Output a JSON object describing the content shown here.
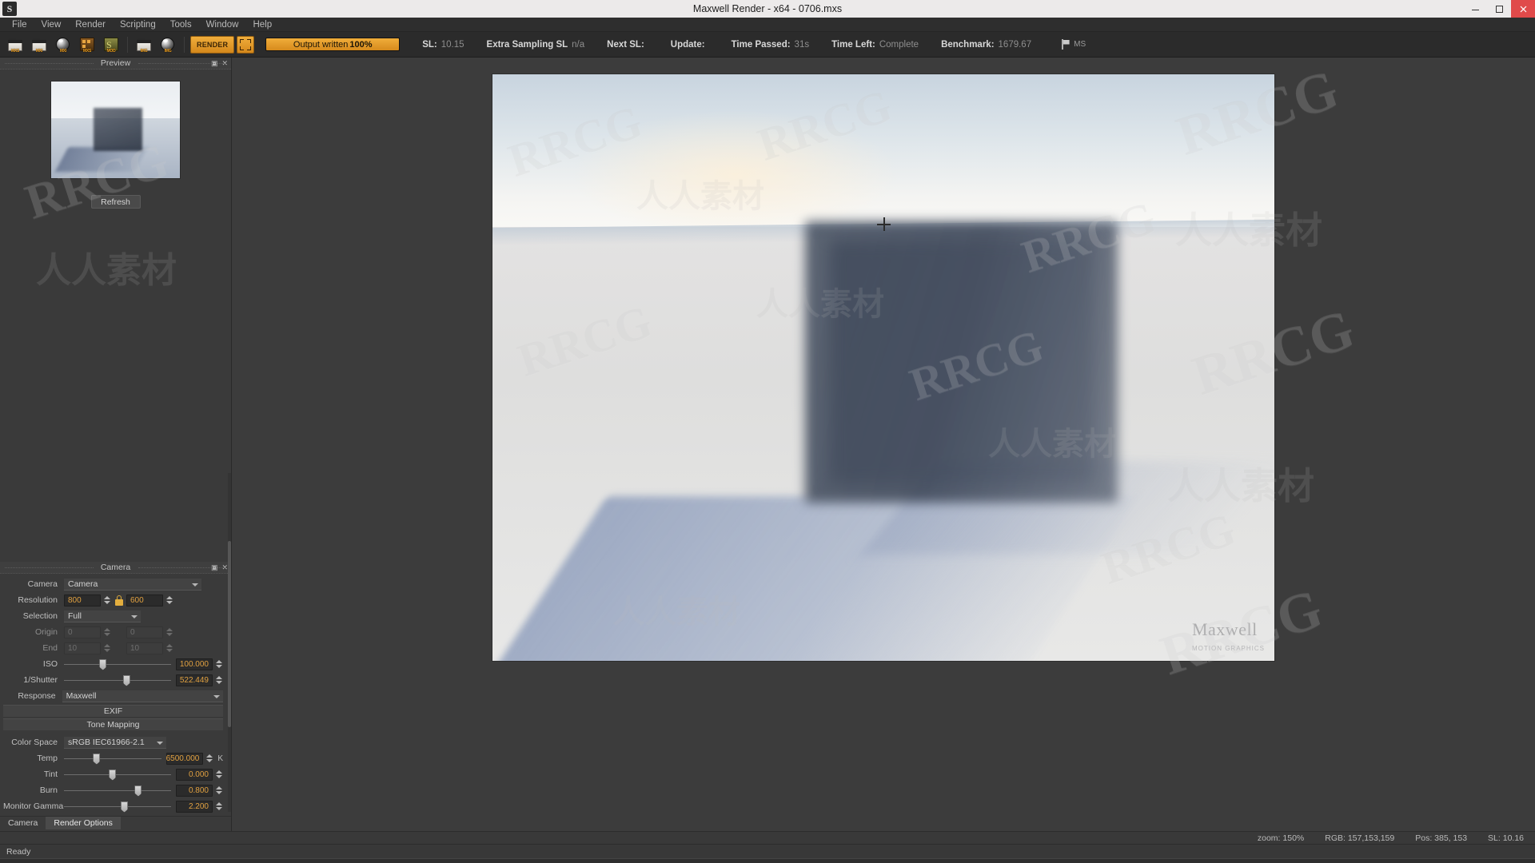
{
  "titlebar": {
    "title": "Maxwell Render  -  x64 - 0706.mxs",
    "logo": "maxwell-logo",
    "minimize": "minimize-button",
    "maximize": "maximize-button",
    "close": "close-button"
  },
  "menubar": {
    "items": [
      {
        "label": "File"
      },
      {
        "label": "View"
      },
      {
        "label": "Render"
      },
      {
        "label": "Scripting"
      },
      {
        "label": "Tools"
      },
      {
        "label": "Window"
      },
      {
        "label": "Help"
      }
    ]
  },
  "toolbar": {
    "buttons": [
      {
        "name": "open-mxs-icon",
        "caption": "MXS"
      },
      {
        "name": "open-mxi-icon",
        "caption": "MXI"
      },
      {
        "name": "save-mxi-icon",
        "caption": "MXI"
      },
      {
        "name": "mxs-material-icon",
        "caption": "MXS"
      },
      {
        "name": "mod-script-icon",
        "caption": "MOD"
      },
      {
        "name": "open-image-icon",
        "caption": "IMG"
      },
      {
        "name": "save-image-icon",
        "caption": "IMG"
      }
    ],
    "render_label": "RENDER",
    "region_label": "region-render",
    "flag_label": "flag-icon",
    "ms_label": "MS"
  },
  "progress": {
    "label": "Output written",
    "percent": "100%",
    "fill": 100,
    "color": "#e0a040"
  },
  "stats": [
    {
      "key": "SL:",
      "value": "10.15"
    },
    {
      "key": "Extra Sampling SL",
      "value": "n/a"
    },
    {
      "key": "Next SL:",
      "value": ""
    },
    {
      "key": "Update:",
      "value": ""
    },
    {
      "key": "Time Passed:",
      "value": "31s"
    },
    {
      "key": "Time Left:",
      "value": "Complete"
    },
    {
      "key": "Benchmark:",
      "value": "1679.67"
    }
  ],
  "preview_panel": {
    "title": "Preview",
    "pin": "▣",
    "close": "✕",
    "refresh_label": "Refresh"
  },
  "camera_panel": {
    "title": "Camera",
    "pin": "▣",
    "close": "✕",
    "camera": {
      "label": "Camera",
      "value": "Camera"
    },
    "resolution": {
      "label": "Resolution",
      "width": "800",
      "height": "600",
      "lock": "locked"
    },
    "selection": {
      "label": "Selection",
      "value": "Full"
    },
    "origin": {
      "label": "Origin",
      "x": "0",
      "y": "0"
    },
    "end": {
      "label": "End",
      "x": "10",
      "y": "10"
    },
    "iso": {
      "label": "ISO",
      "value": "100.000",
      "pos": 36
    },
    "shutter": {
      "label": "1/Shutter",
      "value": "522.449",
      "pos": 58
    },
    "response": {
      "label": "Response",
      "value": "Maxwell"
    },
    "exif_label": "EXIF",
    "tonemapping_label": "Tone Mapping",
    "color_space": {
      "label": "Color Space",
      "value": "sRGB IEC61966-2.1"
    },
    "temp": {
      "label": "Temp",
      "value": "6500.000",
      "unit": "K",
      "pos": 33
    },
    "tint": {
      "label": "Tint",
      "value": "0.000",
      "pos": 45
    },
    "burn": {
      "label": "Burn",
      "value": "0.800",
      "pos": 69
    },
    "monitor_gamma": {
      "label": "Monitor Gamma",
      "value": "2.200",
      "pos": 56
    }
  },
  "tabs": [
    {
      "label": "Camera",
      "active": false
    },
    {
      "label": "Render Options",
      "active": true
    }
  ],
  "viewport": {
    "crosshair": "crosshair-cursor",
    "logo_text": "Maxwell",
    "logo_sub": "MOTION GRAPHICS"
  },
  "info_bar": [
    {
      "text": "zoom: 150%"
    },
    {
      "text": "RGB: 157,153,159"
    },
    {
      "text": "Pos: 385, 153"
    },
    {
      "text": "SL: 10.16"
    }
  ],
  "status_bar": {
    "text": "Ready"
  },
  "watermarks": {
    "rrcg": "RRCG",
    "cn": "人人素材"
  }
}
